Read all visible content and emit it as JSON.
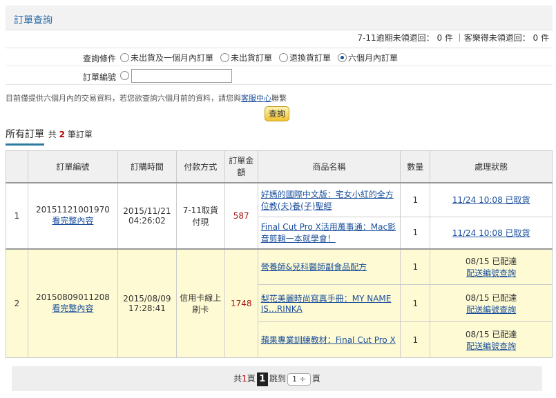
{
  "header": {
    "title": "訂單查詢"
  },
  "stats": {
    "text": "7-11逾期未領退回： 0 件 ｜客樂得未領退回： 0 件"
  },
  "filter": {
    "condition_label": "查詢條件",
    "options": [
      "未出貨及一個月內訂單",
      "未出貨訂單",
      "退換貨訂單",
      "六個月內訂單"
    ],
    "selected_index": 3,
    "order_no_label": "訂單編號",
    "order_no_value": ""
  },
  "note": {
    "prefix": "目前僅提供六個月內的交易資料，若您欲查詢六個月前的資料，請您與",
    "link": "客服中心",
    "suffix": "聯繫"
  },
  "query_button": "查詢",
  "tab": {
    "title": "所有訂單",
    "count_prefix": "共",
    "count": "2",
    "count_suffix": "筆訂單"
  },
  "table": {
    "headers": [
      "",
      "訂單編號",
      "訂購時間",
      "付款方式",
      "訂單金額",
      "商品名稱",
      "數量",
      "處理狀態"
    ],
    "orders": [
      {
        "index": "1",
        "order_no": "20151121001970",
        "detail_link": "看完整內容",
        "date": "2015/11/21",
        "time": "04:26:02",
        "payment": "7-11取貨付現",
        "amount": "587",
        "items": [
          {
            "name": "好媽的國際中文版：宅女小紅的全方位教(夫)養(子)聖經",
            "qty": "1",
            "status": "",
            "status_link": "11/24 10:08 已取貨"
          },
          {
            "name": "Final Cut Pro X活用萬事通：Mac影音剪輯一本就學會！",
            "qty": "1",
            "status": "",
            "status_link": "11/24 10:08 已取貨"
          }
        ]
      },
      {
        "index": "2",
        "order_no": "20150809011208",
        "detail_link": "看完整內容",
        "date": "2015/08/09",
        "time": "17:28:41",
        "payment": "信用卡線上刷卡",
        "amount": "1748",
        "items": [
          {
            "name": "營養師&兒科醫師副食品配方",
            "qty": "1",
            "status": "08/15 已配達",
            "status_link": "配送編號查詢"
          },
          {
            "name": "梨花美麗時尚寫真手冊：MY NAME IS…RINKA",
            "qty": "1",
            "status": "08/15 已配達",
            "status_link": "配送編號查詢"
          },
          {
            "name": "蘋果專業訓練教材：Final Cut Pro X",
            "qty": "1",
            "status": "08/15 已配達",
            "status_link": "配送編號查詢"
          }
        ]
      }
    ]
  },
  "pager": {
    "total_prefix": "共",
    "total_pages": "1",
    "total_suffix": "頁",
    "current_page": "1",
    "jump_label": "跳到",
    "jump_value": "1 ÷",
    "jump_suffix": "頁"
  }
}
